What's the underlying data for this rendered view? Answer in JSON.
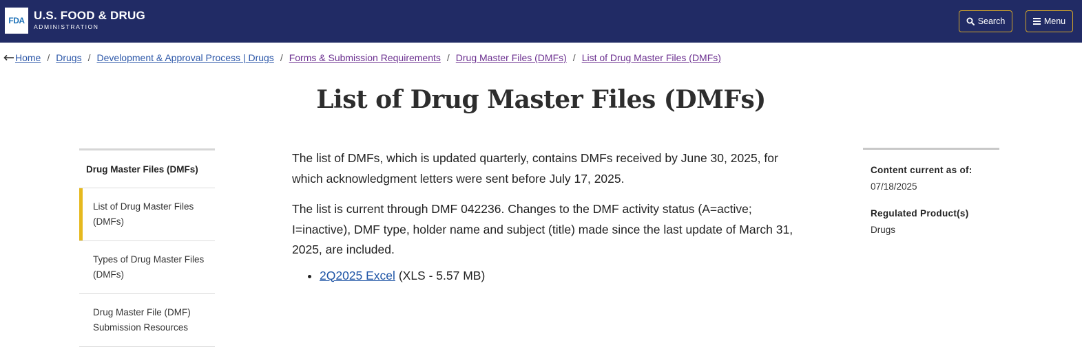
{
  "header": {
    "logo_text": "FDA",
    "brand_main": "U.S. FOOD & DRUG",
    "brand_sub": "ADMINISTRATION",
    "search_label": "Search",
    "menu_label": "Menu",
    "accent_color": "#d4a62a",
    "bg_color": "#212b65"
  },
  "breadcrumb": [
    {
      "label": "Home"
    },
    {
      "label": "Drugs"
    },
    {
      "label": "Development & Approval Process | Drugs"
    },
    {
      "label": "Forms & Submission Requirements"
    },
    {
      "label": "Drug Master Files (DMFs)"
    },
    {
      "label": "List of Drug Master Files (DMFs)"
    }
  ],
  "page_title": "List of Drug Master Files (DMFs)",
  "leftnav": {
    "heading": "Drug Master Files (DMFs)",
    "items": [
      {
        "label": "List of Drug Master Files (DMFs)",
        "active": true
      },
      {
        "label": "Types of Drug Master Files (DMFs)",
        "active": false
      },
      {
        "label": "Drug Master File (DMF) Submission Resources",
        "active": false
      }
    ]
  },
  "main": {
    "paragraph1": "The list of DMFs, which is updated quarterly, contains DMFs received by June 30, 2025, for which acknowledgment letters were sent before July 17, 2025.",
    "paragraph2": "The list is current through DMF 042236. Changes to the DMF activity status (A=active; I=inactive), DMF type, holder name and subject (title) made since the last update of March 31, 2025, are included.",
    "download_link": "2Q2025 Excel",
    "download_meta": "(XLS - 5.57 MB)"
  },
  "sidebar": {
    "content_label": "Content current as of:",
    "content_date": "07/18/2025",
    "regulated_label": "Regulated Product(s)",
    "regulated_value": "Drugs"
  }
}
